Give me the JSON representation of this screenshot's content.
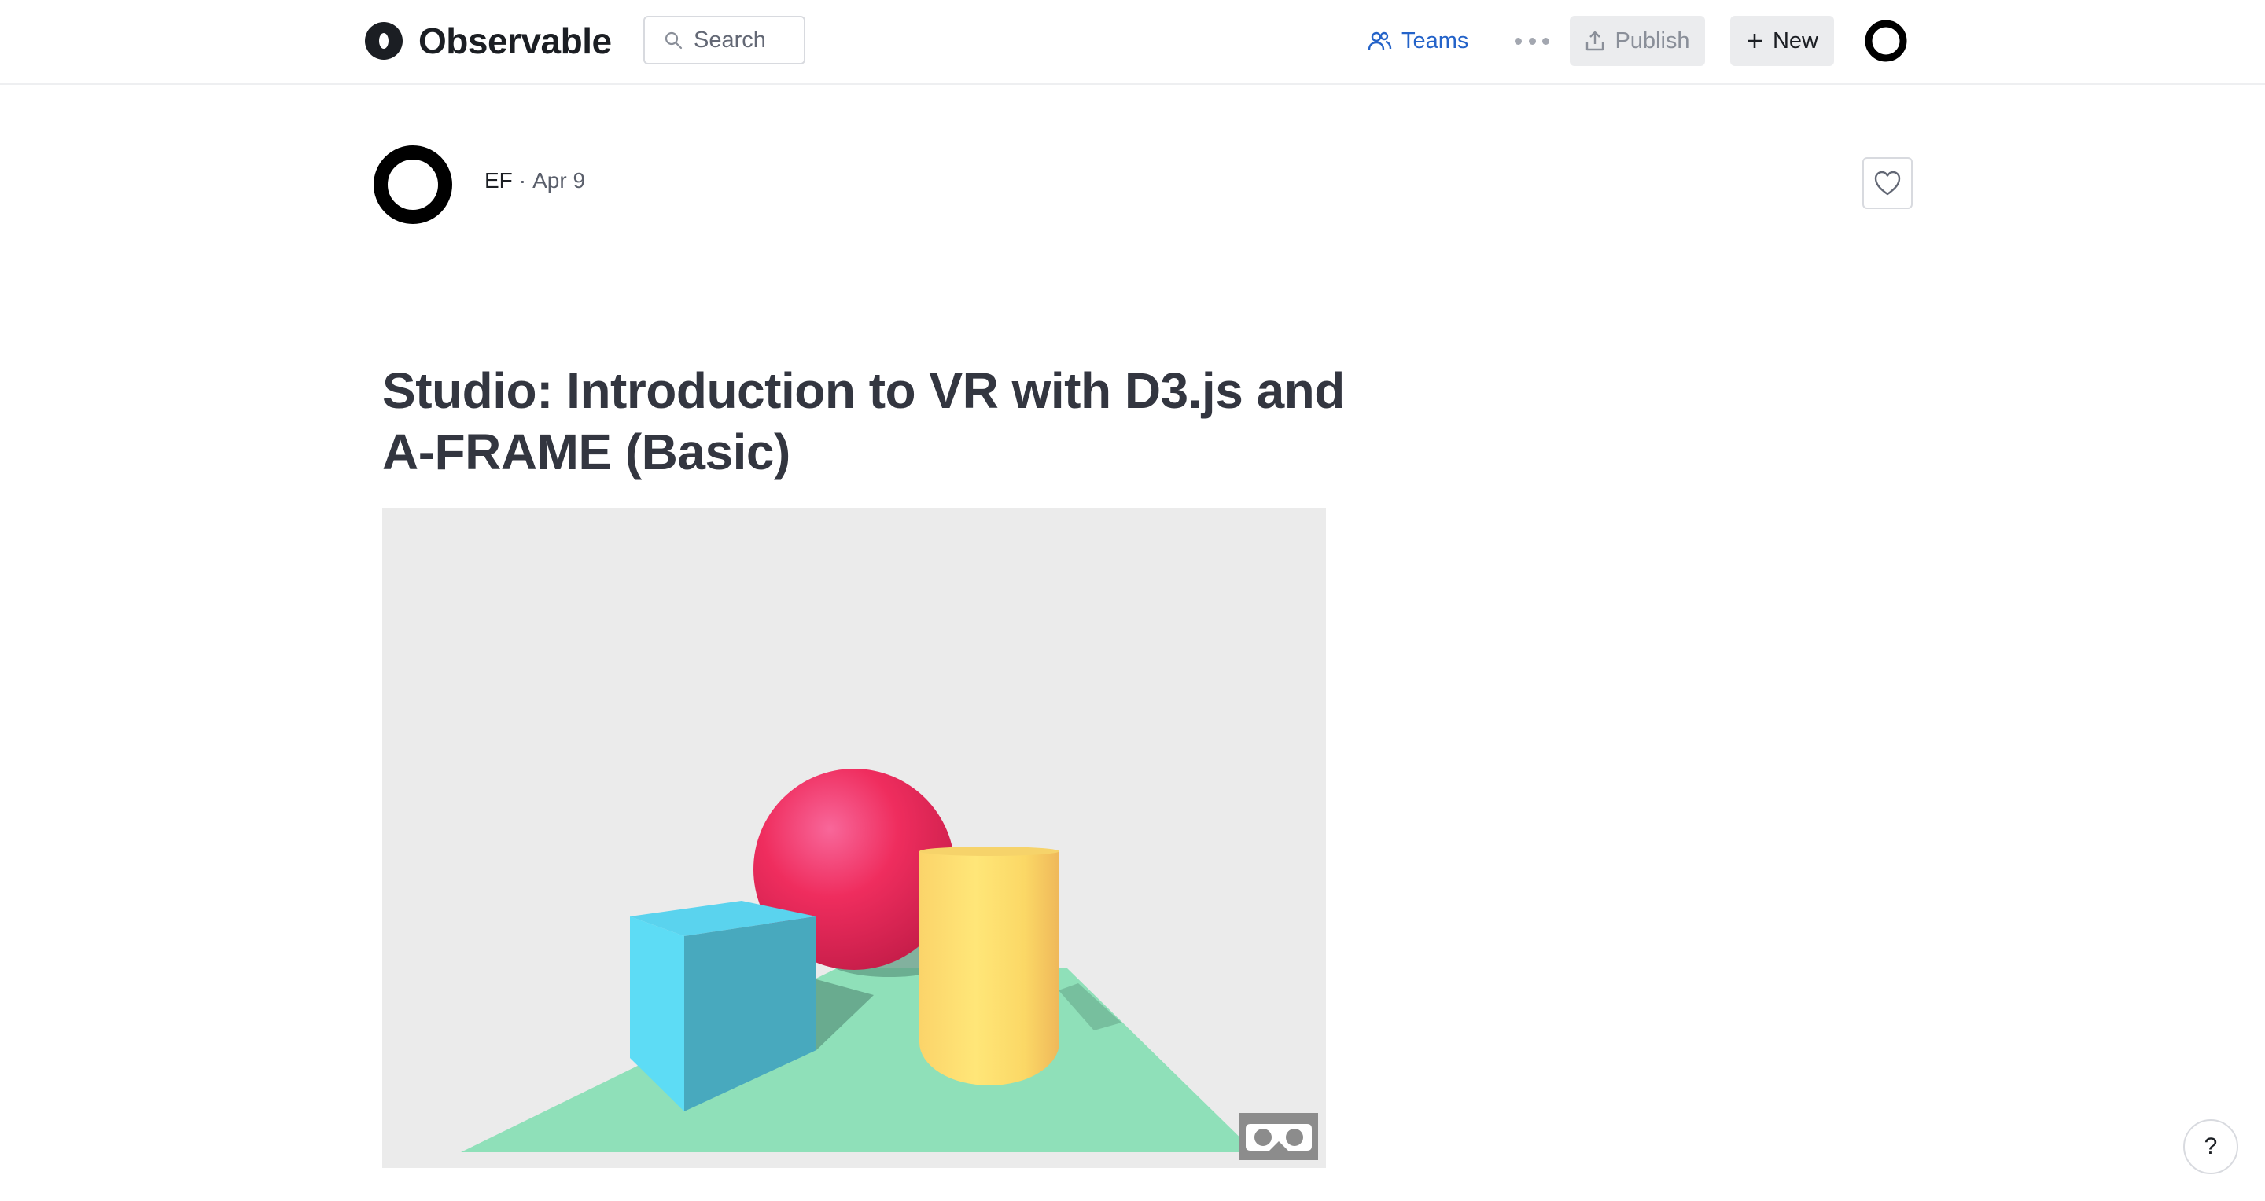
{
  "header": {
    "brand": "Observable",
    "search_placeholder": "Search",
    "teams_label": "Teams",
    "publish_label": "Publish",
    "new_label": "New",
    "icons": [
      "observable-logo-icon",
      "search-icon",
      "teams-icon",
      "more-icon",
      "publish-icon",
      "plus-icon",
      "user-avatar"
    ]
  },
  "notebook": {
    "author": "EF",
    "separator": "·",
    "date": "Apr 9",
    "title_line1": "Studio: Introduction to VR with D3.js and",
    "title_line2": "A-FRAME (Basic)"
  },
  "scene": {
    "objects": [
      "box",
      "sphere",
      "cylinder",
      "plane"
    ],
    "colors": {
      "background": "#ebebeb",
      "box": "#5ddcf5",
      "sphere": "#ef2d5e",
      "cylinder": "#ffe36f",
      "plane": "#8fe0b9"
    }
  },
  "help_label": "?",
  "colors": {
    "accent": "#2463c9",
    "text": "#1b1e23",
    "muted": "#636875"
  }
}
